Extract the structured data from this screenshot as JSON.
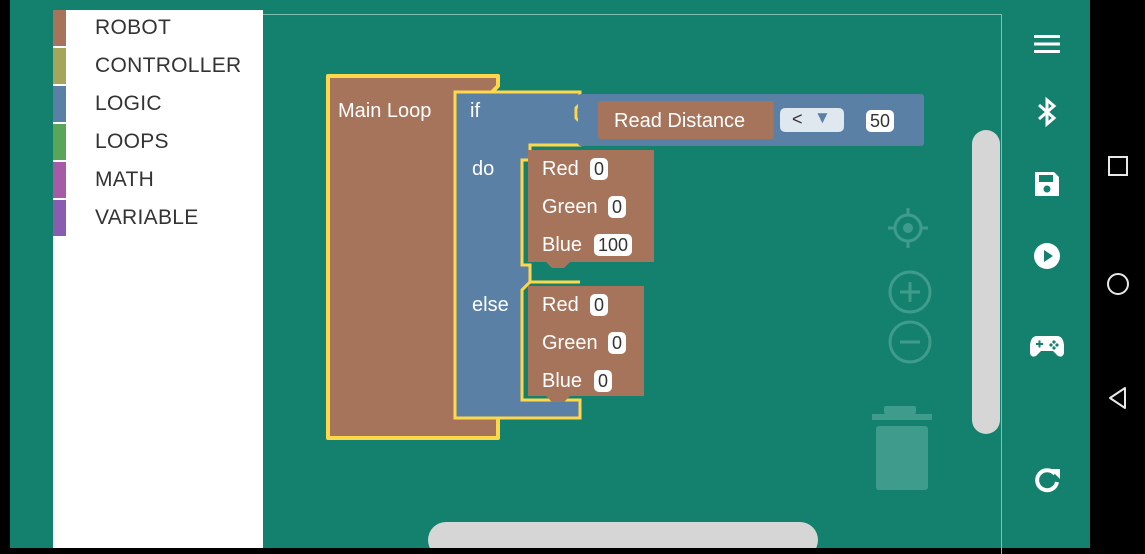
{
  "colors": {
    "workspace": "#14806e",
    "robot": "#a6745b",
    "controller": "#a5a55b",
    "logic": "#5b80a5",
    "loops": "#5ba55b",
    "math": "#a55ba5",
    "variable": "#9a5ca5",
    "highlight": "#ffd74a"
  },
  "toolbox": {
    "categories": [
      {
        "label": "ROBOT",
        "color": "#a6745b"
      },
      {
        "label": "CONTROLLER",
        "color": "#a5a55b"
      },
      {
        "label": "LOGIC",
        "color": "#5b80a5"
      },
      {
        "label": "LOOPS",
        "color": "#5ba55b"
      },
      {
        "label": "MATH",
        "color": "#a55ba5"
      },
      {
        "label": "VARIABLE",
        "color": "#8a5cb0"
      }
    ]
  },
  "blocks": {
    "main_loop_label": "Main Loop",
    "if_label": "if",
    "do_label": "do",
    "else_label": "else",
    "read_distance_label": "Read Distance",
    "operator": "<",
    "compare_value": "50",
    "do_led": {
      "red_label": "Red",
      "red": "0",
      "green_label": "Green",
      "green": "0",
      "blue_label": "Blue",
      "blue": "100"
    },
    "else_led": {
      "red_label": "Red",
      "red": "0",
      "green_label": "Green",
      "green": "0",
      "blue_label": "Blue",
      "blue": "0"
    }
  },
  "right_toolbar": {
    "icons": [
      "menu-icon",
      "bluetooth-icon",
      "save-icon",
      "play-icon",
      "gamepad-icon",
      "refresh-icon"
    ]
  },
  "workspace_controls": {
    "icons": [
      "recenter-icon",
      "zoom-in-icon",
      "zoom-out-icon",
      "trash-icon"
    ]
  },
  "android_nav": {
    "icons": [
      "recents-icon",
      "home-icon",
      "back-icon"
    ]
  }
}
